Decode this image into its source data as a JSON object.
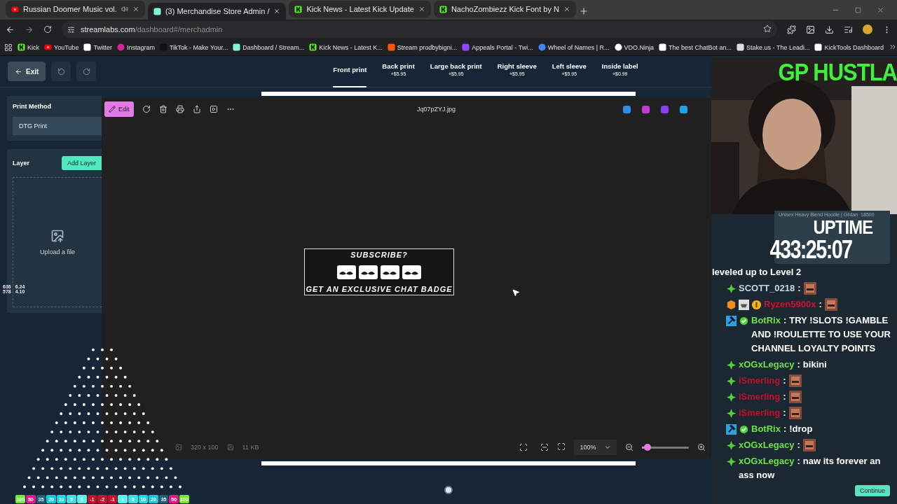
{
  "browser": {
    "tabs": [
      {
        "title": "Russian Doomer Music vol.",
        "kind": "youtube",
        "selected": false,
        "audio": true
      },
      {
        "title": "(3) Merchandise Store Admin /",
        "kind": "streamlabs",
        "selected": true,
        "audio": false
      },
      {
        "title": "Kick News - Latest Kick Update",
        "kind": "kick",
        "selected": false,
        "audio": false
      },
      {
        "title": "NachoZombiezz Kick Font by N",
        "kind": "kick",
        "selected": false,
        "audio": false
      }
    ],
    "url": {
      "domain": "streamlabs.com",
      "path": "/dashboard#/merchadmin"
    },
    "bookmarks": [
      {
        "label": "Kick",
        "kind": "kick"
      },
      {
        "label": "YouTube",
        "kind": "youtube"
      },
      {
        "label": "Twitter",
        "kind": "x"
      },
      {
        "label": "Instagram",
        "kind": "instagram"
      },
      {
        "label": "TikTok - Make Your...",
        "kind": "tiktok"
      },
      {
        "label": "Dashboard / Stream...",
        "kind": "streamlabs"
      },
      {
        "label": "Kick News - Latest K...",
        "kind": "kick"
      },
      {
        "label": "Stream prodbybigni...",
        "kind": "soundcloud"
      },
      {
        "label": "Appeals Portal - Twi...",
        "kind": "twitch"
      },
      {
        "label": "Wheel of Names | R...",
        "kind": "wheel"
      },
      {
        "label": "VDO.Ninja",
        "kind": "vdo"
      },
      {
        "label": "The best ChatBot an...",
        "kind": "chatbot"
      },
      {
        "label": "Stake.us - The Leadi...",
        "kind": "stake"
      },
      {
        "label": "KickTools Dashboard",
        "kind": "grid"
      }
    ]
  },
  "editor": {
    "exit": "Exit",
    "print_tabs": [
      {
        "label": "Front print",
        "selected": true
      },
      {
        "label": "Back print",
        "price": "+$5.95",
        "selected": false
      },
      {
        "label": "Large back print",
        "price": "+$5.95",
        "selected": false
      },
      {
        "label": "Right sleeve",
        "price": "+$5.95",
        "selected": false
      },
      {
        "label": "Left sleeve",
        "price": "+$5.95",
        "selected": false
      },
      {
        "label": "Inside label",
        "price": "+$0.99",
        "selected": false
      }
    ],
    "print_method": {
      "label": "Print Method",
      "value": "DTG Print"
    },
    "layer": {
      "label": "Layer",
      "button": "Add Layer",
      "upload": "Upload a file"
    },
    "stats": [
      [
        "636",
        "6.24"
      ],
      [
        "578",
        "4.10"
      ]
    ]
  },
  "viewer": {
    "edit": "Edit",
    "filename": "Jq07pZYJ.jpg",
    "dimensions": "320 x 100",
    "size": "11 KB",
    "zoom": "100%",
    "level": 0.12,
    "banner": {
      "top": "SUBSCRIBE?",
      "bottom": "GET AN EXCLUSIVE CHAT BADGE"
    }
  },
  "stream": {
    "title": "GP HUSTLA",
    "uptime_label": "UPTIME",
    "uptime": "433:25:07",
    "product": [
      "Unisex Heavy Blend Hoodie | Gildan",
      "18500"
    ],
    "plinko": [
      {
        "label": "100",
        "color": "#6ee83a"
      },
      {
        "label": "50",
        "color": "#e0198a"
      },
      {
        "label": "35",
        "color": "#1d5f7a"
      },
      {
        "label": "20",
        "color": "#22c4d8"
      },
      {
        "label": "10",
        "color": "#28d4e0"
      },
      {
        "label": "5",
        "color": "#3ee0e6"
      },
      {
        "label": "1",
        "color": "#5ef0ea"
      },
      {
        "label": "-1",
        "color": "#c8102e"
      },
      {
        "label": "-2",
        "color": "#c8102e"
      },
      {
        "label": "-1",
        "color": "#c8102e"
      },
      {
        "label": "1",
        "color": "#5ef0ea"
      },
      {
        "label": "5",
        "color": "#3ee0e6"
      },
      {
        "label": "10",
        "color": "#28d4e0"
      },
      {
        "label": "20",
        "color": "#22c4d8"
      },
      {
        "label": "35",
        "color": "#1d5f7a"
      },
      {
        "label": "50",
        "color": "#e0198a"
      },
      {
        "label": "100",
        "color": "#6ee83a"
      }
    ],
    "chat": [
      {
        "kind": "notice",
        "text": "leveled up to Level 2"
      },
      {
        "kind": "sub",
        "user": "SCOTT_0218",
        "color": "#c9d3e6",
        "separator": ":",
        "emote": true
      },
      {
        "kind": "gifter",
        "user": "Ryzen5900x",
        "color": "#d0122f",
        "separator": ":",
        "emote": true
      },
      {
        "kind": "bot",
        "user": "BotRix",
        "color": "#6fe04c",
        "separator": ":",
        "text": "TRY !SLOTS !GAMBLE AND !ROULETTE TO USE YOUR CHANNEL LOYALTY POINTS"
      },
      {
        "kind": "sub",
        "user": "xOGxLegacy",
        "color": "#6fe04c",
        "separator": ":",
        "text": "bikini"
      },
      {
        "kind": "sub",
        "user": "iSmerling",
        "color": "#c0102a",
        "separator": ":",
        "emote": true
      },
      {
        "kind": "sub",
        "user": "iSmerling",
        "color": "#c0102a",
        "separator": ":",
        "emote": true
      },
      {
        "kind": "sub",
        "user": "iSmerling",
        "color": "#c0102a",
        "separator": ":",
        "emote": true
      },
      {
        "kind": "bot",
        "user": "BotRix",
        "color": "#6fe04c",
        "separator": ":",
        "text": "!drop"
      },
      {
        "kind": "sub",
        "user": "xOGxLegacy",
        "color": "#6fe04c",
        "separator": ":",
        "emote": true
      },
      {
        "kind": "sub",
        "user": "xOGxLegacy",
        "color": "#6fe04c",
        "separator": ":",
        "text": "naw its forever an ass now"
      }
    ],
    "continue": "Continue"
  }
}
